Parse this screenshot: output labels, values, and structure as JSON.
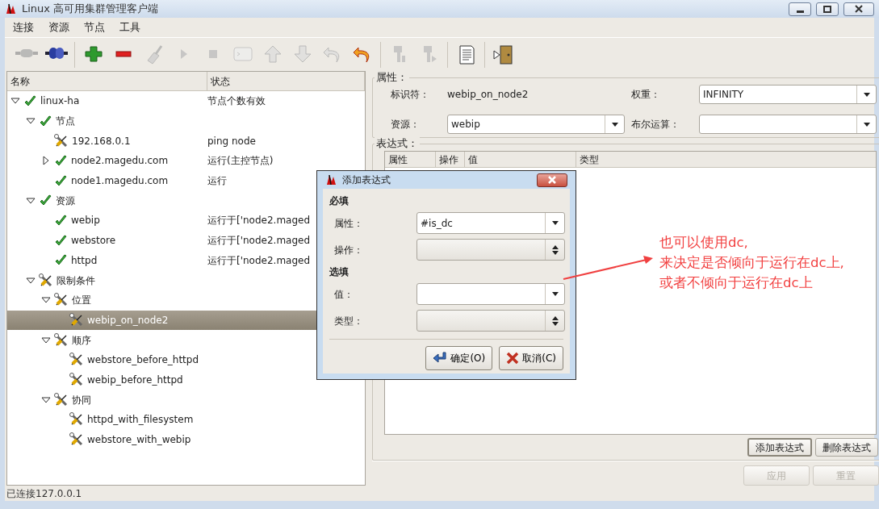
{
  "window": {
    "title": "Linux 高可用集群管理客户端"
  },
  "menu": [
    "连接",
    "资源",
    "节点",
    "工具"
  ],
  "toolbar": [
    [
      {
        "kind": "plug",
        "disabled": true
      },
      {
        "kind": "plug-connect",
        "disabled": false
      }
    ],
    [
      {
        "kind": "add",
        "disabled": false
      },
      {
        "kind": "remove",
        "disabled": false
      },
      {
        "kind": "broom",
        "disabled": true
      },
      {
        "kind": "play",
        "disabled": true
      },
      {
        "kind": "stop",
        "disabled": true
      },
      {
        "kind": "terminal",
        "disabled": true
      },
      {
        "kind": "up",
        "disabled": true
      },
      {
        "kind": "down",
        "disabled": true
      },
      {
        "kind": "undo",
        "disabled": true
      },
      {
        "kind": "undo",
        "disabled": false
      }
    ],
    [
      {
        "kind": "migrate",
        "disabled": true
      },
      {
        "kind": "unmigrate",
        "disabled": true
      }
    ],
    [
      {
        "kind": "log",
        "disabled": false
      }
    ],
    [
      {
        "kind": "exit",
        "disabled": false
      }
    ]
  ],
  "tree": {
    "columns": [
      "名称",
      "状态"
    ],
    "items": [
      {
        "name": "linux-ha",
        "status": "节点个数有效",
        "kind": "check",
        "expanded": true,
        "selected": false,
        "children": [
          {
            "name": "节点",
            "kind": "check",
            "expanded": true,
            "selected": false,
            "children": [
              {
                "name": "192.168.0.1",
                "status": "ping node",
                "kind": "tools",
                "selected": false
              },
              {
                "name": "node2.magedu.com",
                "status": "运行(主控节点)",
                "kind": "check",
                "expanded": false,
                "selected": false
              },
              {
                "name": "node1.magedu.com",
                "status": "运行",
                "kind": "check",
                "selected": false
              }
            ]
          },
          {
            "name": "资源",
            "kind": "check",
            "expanded": true,
            "selected": false,
            "children": [
              {
                "name": "webip",
                "status": "运行于['node2.maged",
                "kind": "check",
                "selected": false
              },
              {
                "name": "webstore",
                "status": "运行于['node2.maged",
                "kind": "check",
                "selected": false
              },
              {
                "name": "httpd",
                "status": "运行于['node2.maged",
                "kind": "check",
                "selected": false
              }
            ]
          },
          {
            "name": "限制条件",
            "kind": "tools",
            "expanded": true,
            "selected": false,
            "children": [
              {
                "name": "位置",
                "kind": "tools",
                "expanded": true,
                "selected": false,
                "children": [
                  {
                    "name": "webip_on_node2",
                    "kind": "tools",
                    "selected": true
                  }
                ]
              },
              {
                "name": "顺序",
                "kind": "tools",
                "expanded": true,
                "selected": false,
                "children": [
                  {
                    "name": "webstore_before_httpd",
                    "kind": "tools",
                    "selected": false
                  },
                  {
                    "name": "webip_before_httpd",
                    "kind": "tools",
                    "selected": false
                  }
                ]
              },
              {
                "name": "协同",
                "kind": "tools",
                "expanded": true,
                "selected": false,
                "children": [
                  {
                    "name": "httpd_with_filesystem",
                    "kind": "tools",
                    "selected": false
                  },
                  {
                    "name": "webstore_with_webip",
                    "kind": "tools",
                    "selected": false
                  }
                ]
              }
            ]
          }
        ]
      }
    ]
  },
  "properties": {
    "legend": "属性：",
    "identifier_label": "标识符：",
    "identifier": "webip_on_node2",
    "score_label": "权重：",
    "score": "INFINITY",
    "resource_label": "资源：",
    "resource": "webip",
    "boolean_label": "布尔运算："
  },
  "expressions": {
    "legend": "表达式：",
    "columns": [
      "属性",
      "操作",
      "值",
      "类型"
    ],
    "buttons": [
      {
        "label": "添加表达式",
        "default": true
      },
      {
        "label": "删除表达式",
        "default": false
      }
    ]
  },
  "actions": [
    {
      "label": "应用",
      "disabled": true
    },
    {
      "label": "重置",
      "disabled": true
    }
  ],
  "status_bar": "已连接127.0.0.1",
  "dialog": {
    "title": "添加表达式",
    "sections": [
      {
        "title": "必填",
        "fields": [
          {
            "label": "属性：",
            "kind": "combo",
            "value": "#is_dc"
          },
          {
            "label": "操作：",
            "kind": "spin"
          }
        ]
      },
      {
        "title": "选填",
        "fields": [
          {
            "label": "值：",
            "kind": "combo"
          },
          {
            "label": "类型：",
            "kind": "spin"
          }
        ]
      }
    ],
    "buttons": [
      {
        "label": "确定(O)",
        "kind": "ok"
      },
      {
        "label": "取消(C)",
        "kind": "cancel"
      }
    ]
  },
  "annotation": {
    "lines": [
      "也可以使用dc,",
      "来决定是否倾向于运行在dc上,",
      "或者不倾向于运行在dc上"
    ]
  }
}
